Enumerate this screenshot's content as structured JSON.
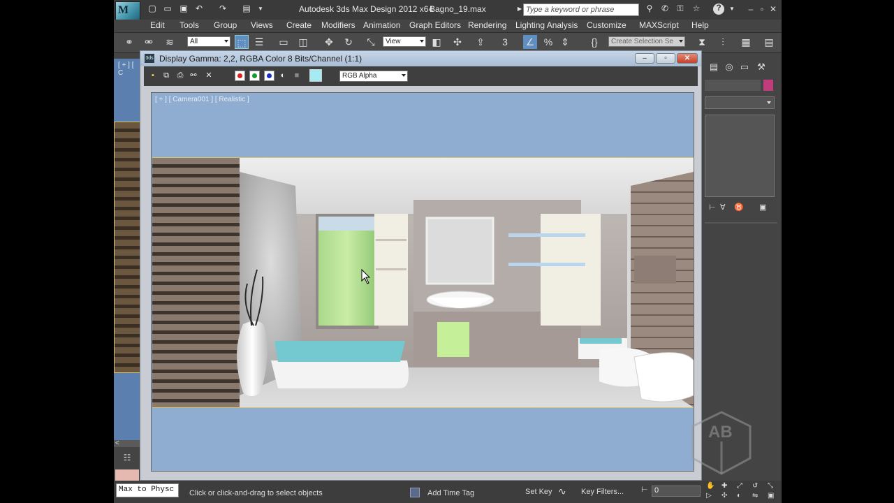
{
  "title_bar": {
    "app_title": "Autodesk 3ds Max Design 2012 x64",
    "file_name": "Bagno_19.max",
    "search_placeholder": "Type a keyword or phrase",
    "logo_text": "M",
    "logo_sub": "3ds"
  },
  "menu": {
    "items": [
      "Edit",
      "Tools",
      "Group",
      "Views",
      "Create",
      "Modifiers",
      "Animation",
      "Graph Editors",
      "Rendering",
      "Lighting Analysis",
      "Customize",
      "MAXScript",
      "Help"
    ]
  },
  "toolbar": {
    "selection_filter": "All",
    "reference_coord": "View",
    "snap_value": "3",
    "named_selection_placeholder": "Create Selection Se"
  },
  "left_viewport": {
    "label": "[ + ] [ C"
  },
  "frame_buffer": {
    "title": "Display Gamma: 2,2, RGBA Color 8 Bits/Channel (1:1)",
    "channel_display": "RGB Alpha",
    "viewport_label": "[ + ] [ Camera001 ] [ Realistic ]"
  },
  "status_bar": {
    "maxscript_listener": "Max to Physc",
    "prompt": "Click or click-and-drag to select objects",
    "add_time_tag": "Add Time Tag",
    "set_key": "Set Key",
    "key_filters": "Key Filters...",
    "frame_value": "0"
  },
  "watermark": {
    "text": "AB"
  },
  "colors": {
    "viewport_background": "#8fadd1",
    "app_chrome": "#444444",
    "frame_buffer_title": "#b6c8dc",
    "selection_highlight": "#d5c86a",
    "tub_water": "#74c9d1",
    "towel": "#c6ef9a"
  }
}
